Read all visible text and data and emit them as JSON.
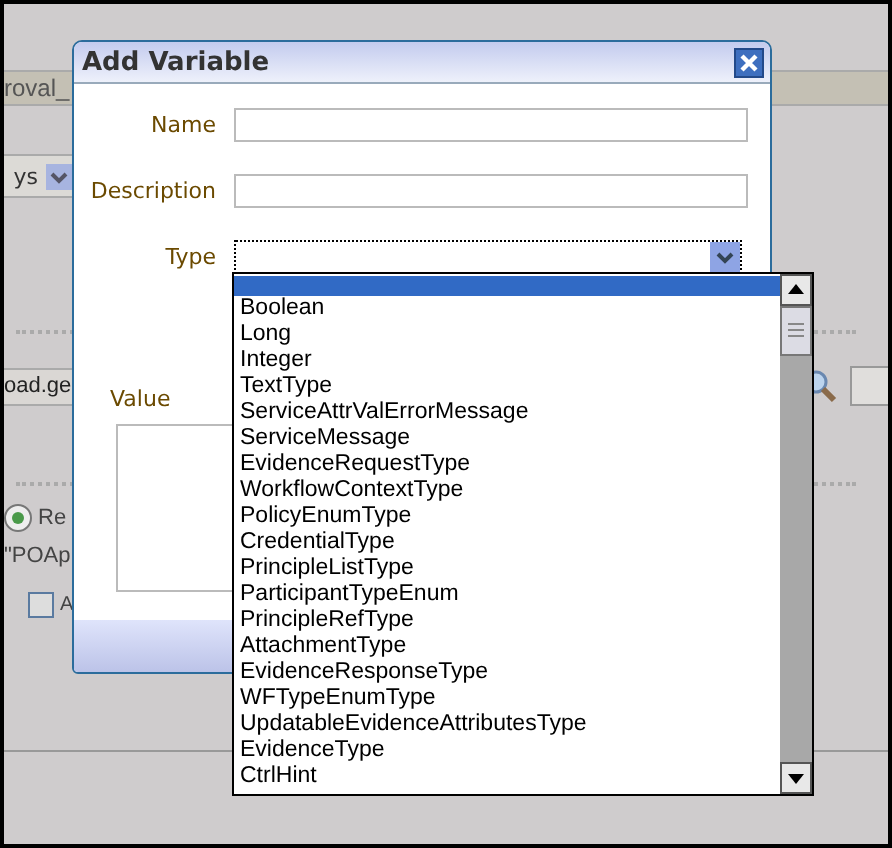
{
  "background": {
    "tab_title": "roval_",
    "select_value": "ys",
    "field_value": "oad.ge",
    "radio": {
      "label": "Re",
      "selected": true
    },
    "text": "\"POAp",
    "checkbox": {
      "label": "A",
      "checked": false
    }
  },
  "dialog": {
    "title": "Add Variable",
    "fields": [
      {
        "label": "Name",
        "kind": "text"
      },
      {
        "label": "Description",
        "kind": "text"
      },
      {
        "label": "Type",
        "kind": "select"
      },
      {
        "label": "Value",
        "kind": "textarea"
      }
    ]
  },
  "dropdown": {
    "blank_option_highlighted": true,
    "options": [
      "Boolean",
      "Long",
      "Integer",
      "TextType",
      "ServiceAttrValErrorMessage",
      "ServiceMessage",
      "EvidenceRequestType",
      "WorkflowContextType",
      "PolicyEnumType",
      "CredentialType",
      "PrincipleListType",
      "ParticipantTypeEnum",
      "PrincipleRefType",
      "AttachmentType",
      "EvidenceResponseType",
      "WFTypeEnumType",
      "UpdatableEvidenceAttributesType",
      "EvidenceType",
      "CtrlHint"
    ]
  }
}
